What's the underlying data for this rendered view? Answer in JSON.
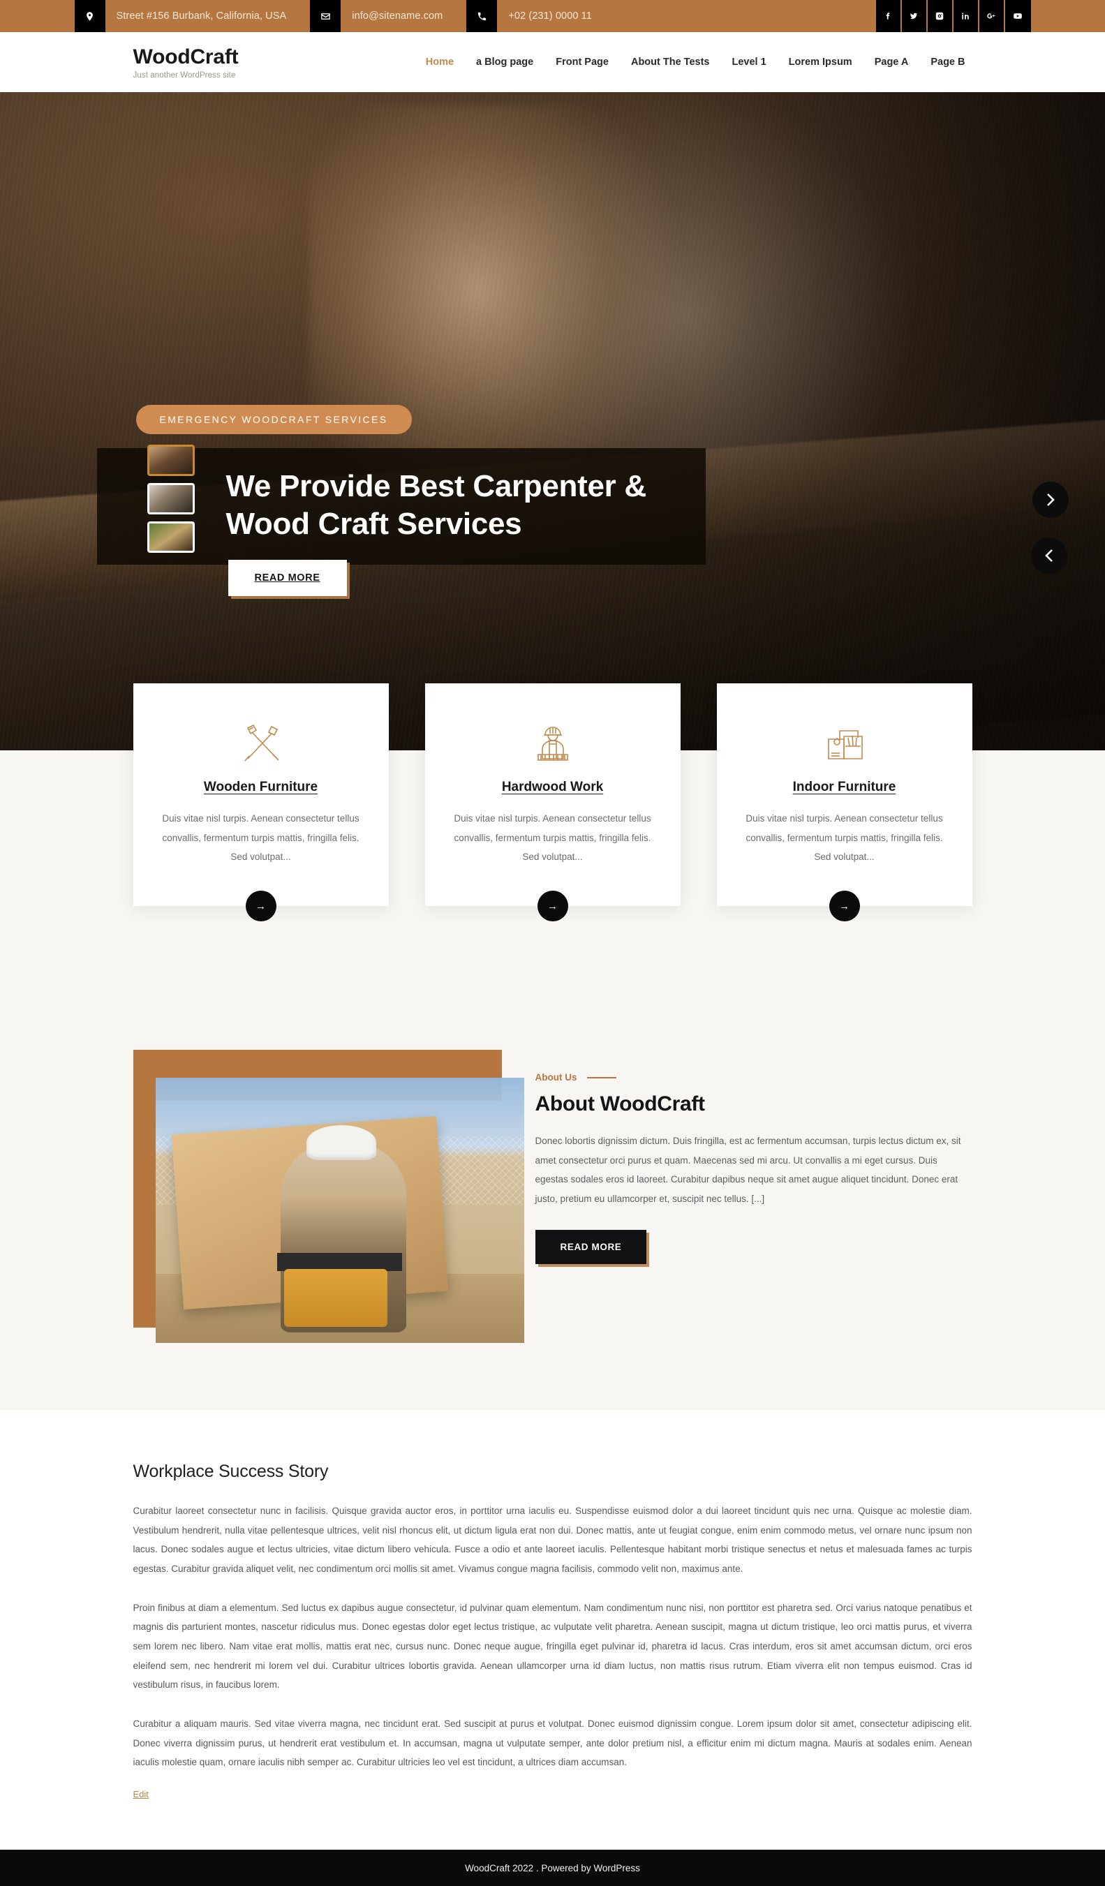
{
  "topbar": {
    "address": "Street #156 Burbank, California, USA",
    "email": "info@sitename.com",
    "phone": "+02 (231) 0000 11",
    "social": [
      {
        "name": "facebook-icon",
        "label": "Facebook"
      },
      {
        "name": "twitter-icon",
        "label": "Twitter"
      },
      {
        "name": "instagram-icon",
        "label": "Instagram"
      },
      {
        "name": "linkedin-icon",
        "label": "LinkedIn"
      },
      {
        "name": "google-plus-icon",
        "label": "Google Plus"
      },
      {
        "name": "youtube-icon",
        "label": "YouTube"
      }
    ],
    "bg_color": "#b5773f"
  },
  "header": {
    "site_title": "WoodCraft",
    "tagline": "Just another WordPress site",
    "nav": [
      {
        "label": "Home",
        "active": true
      },
      {
        "label": "a Blog page",
        "active": false
      },
      {
        "label": "Front Page",
        "active": false
      },
      {
        "label": "About The Tests",
        "active": false
      },
      {
        "label": "Level 1",
        "active": false
      },
      {
        "label": "Lorem Ipsum",
        "active": false
      },
      {
        "label": "Page A",
        "active": false
      },
      {
        "label": "Page B",
        "active": false
      }
    ],
    "accent_color": "#c08a4e"
  },
  "hero": {
    "badge": "EMERGENCY WOODCRAFT SERVICES",
    "title": "We Provide Best Carpenter & Wood Craft Services",
    "button": "READ MORE",
    "thumbnails": [
      {
        "label": "slide-1",
        "active": true
      },
      {
        "label": "slide-2",
        "active": false
      },
      {
        "label": "slide-3",
        "active": false
      }
    ],
    "next_label": "Next slide",
    "prev_label": "Previous slide",
    "badge_color": "#d08b50"
  },
  "services": [
    {
      "icon": "hammer-and-saw-icon",
      "title": "Wooden Furniture",
      "text": "Duis vitae nisl turpis. Aenean consectetur tellus convallis, fermentum turpis mattis, fringilla felis. Sed volutpat...",
      "arrow": "→"
    },
    {
      "icon": "worker-icon",
      "title": "Hardwood Work",
      "text": "Duis vitae nisl turpis. Aenean consectetur tellus convallis, fermentum turpis mattis, fringilla felis. Sed volutpat...",
      "arrow": "→"
    },
    {
      "icon": "toolbox-icon",
      "title": "Indoor Furniture",
      "text": "Duis vitae nisl turpis. Aenean consectetur tellus convallis, fermentum turpis mattis, fringilla felis. Sed volutpat...",
      "arrow": "→"
    }
  ],
  "about": {
    "eyebrow": "About Us",
    "title": "About WoodCraft",
    "text": "Donec lobortis dignissim dictum. Duis fringilla, est ac fermentum accumsan, turpis lectus dictum ex, sit amet consectetur orci purus et quam. Maecenas sed mi arcu. Ut convallis a mi eget cursus. Duis egestas sodales eros id laoreet. Curabitur dapibus neque sit amet augue aliquet tincidunt. Donec erat justo, pretium eu ullamcorper et, suscipit nec tellus. [...]",
    "button": "READ MORE",
    "image_alt": "Construction worker carrying a plywood board"
  },
  "content": {
    "heading": "Workplace Success Story",
    "paragraphs": [
      "Curabitur laoreet consectetur nunc in facilisis. Quisque gravida auctor eros, in porttitor urna iaculis eu. Suspendisse euismod dolor a dui laoreet tincidunt quis nec urna. Quisque ac molestie diam. Vestibulum hendrerit, nulla vitae pellentesque ultrices, velit nisl rhoncus elit, ut dictum ligula erat non dui. Donec mattis, ante ut feugiat congue, enim enim commodo metus, vel ornare nunc ipsum non lacus. Donec sodales augue et lectus ultricies, vitae dictum libero vehicula. Fusce a odio et ante laoreet iaculis. Pellentesque habitant morbi tristique senectus et netus et malesuada fames ac turpis egestas. Curabitur gravida aliquet velit, nec condimentum orci mollis sit amet. Vivamus congue magna facilisis, commodo velit non, maximus ante.",
      "Proin finibus at diam a elementum. Sed luctus ex dapibus augue consectetur, id pulvinar quam elementum. Nam condimentum nunc nisi, non porttitor est pharetra sed. Orci varius natoque penatibus et magnis dis parturient montes, nascetur ridiculus mus. Donec egestas dolor eget lectus tristique, ac vulputate velit pharetra. Aenean suscipit, magna ut dictum tristique, leo orci mattis purus, et viverra sem lorem nec libero. Nam vitae erat mollis, mattis erat nec, cursus nunc. Donec neque augue, fringilla eget pulvinar id, pharetra id lacus. Cras interdum, eros sit amet accumsan dictum, orci eros eleifend sem, nec hendrerit mi lorem vel dui. Curabitur ultrices lobortis gravida. Aenean ullamcorper urna id diam luctus, non mattis risus rutrum. Etiam viverra elit non tempus euismod. Cras id vestibulum risus, in faucibus lorem.",
      "Curabitur a aliquam mauris. Sed vitae viverra magna, nec tincidunt erat. Sed suscipit at purus et volutpat. Donec euismod dignissim congue. Lorem ipsum dolor sit amet, consectetur adipiscing elit. Donec viverra dignissim purus, ut hendrerit erat vestibulum et. In accumsan, magna ut vulputate semper, ante dolor pretium nisl, a efficitur enim mi dictum magna. Mauris at sodales enim. Aenean iaculis molestie quam, ornare iaculis nibh semper ac. Curabitur ultricies leo vel est tincidunt, a ultrices diam accumsan."
    ],
    "edit_link": "Edit"
  },
  "footer": {
    "text": "WoodCraft 2022 . Powered by WordPress"
  }
}
